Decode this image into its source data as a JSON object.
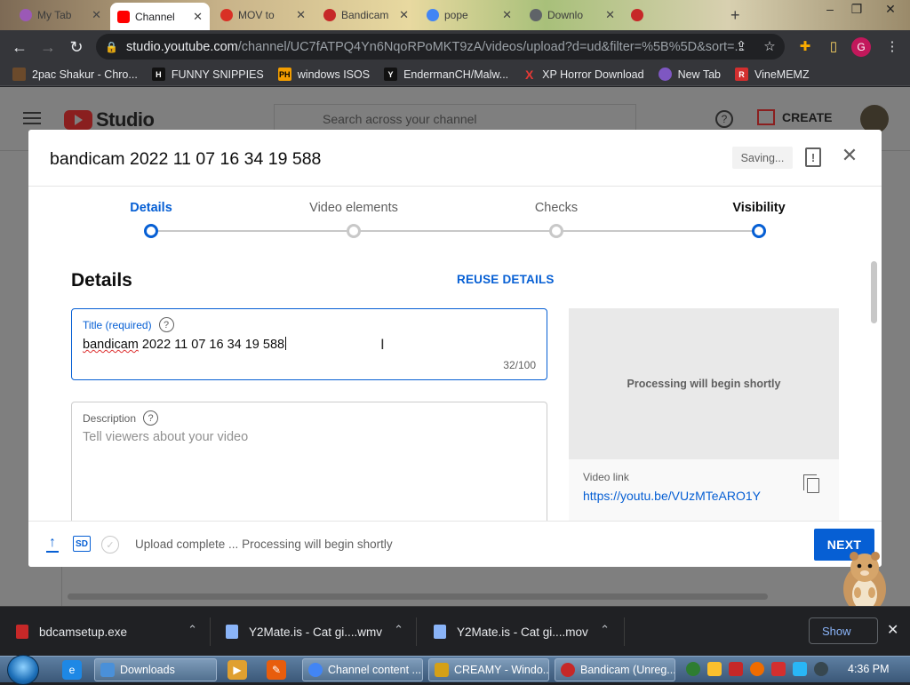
{
  "browser": {
    "tabs": [
      {
        "label": "My Tab",
        "fav": "#9b59b6"
      },
      {
        "label": "Channel",
        "fav": "#ff0000"
      },
      {
        "label": "MOV to",
        "fav": "#d93025"
      },
      {
        "label": "Bandicam",
        "fav": "#c62828"
      },
      {
        "label": "pope",
        "fav": "#4285f4"
      },
      {
        "label": "Downlo",
        "fav": "#5f6368"
      },
      {
        "label": "",
        "fav": "#c62828"
      }
    ],
    "new_tab": "+",
    "url_host": "studio.youtube.com",
    "url_path": "/channel/UC7fATPQ4Yn6NqoRPoMKT9zA/videos/upload?d=ud&filter=%5B%5D&sort=...",
    "profile_letter": "G"
  },
  "bookmarks": [
    {
      "label": "2pac Shakur - Chro...",
      "icon": "2pac-icon",
      "color": "#6b4a2b",
      "glyph": ""
    },
    {
      "label": "FUNNY SNIPPIES",
      "icon": "h-icon",
      "color": "#111111",
      "glyph": "H"
    },
    {
      "label": "windows ISOS",
      "icon": "ph-icon",
      "color": "#f29d00",
      "glyph": "PH"
    },
    {
      "label": "EndermanCH/Malw...",
      "icon": "yp-icon",
      "color": "#111111",
      "glyph": "Y"
    },
    {
      "label": "XP Horror Download",
      "icon": "x-icon",
      "color": "#e53935",
      "glyph": "X"
    },
    {
      "label": "New Tab",
      "icon": "globe-icon",
      "color": "#7e57c2",
      "glyph": ""
    },
    {
      "label": "VineMEMZ",
      "icon": "r-icon",
      "color": "#d32f2f",
      "glyph": "R"
    }
  ],
  "studio": {
    "logo_text": "Studio",
    "search_placeholder": "Search across your channel",
    "create_label": "CREATE"
  },
  "modal": {
    "title": "bandicam 2022 11 07 16 34 19 588",
    "saving_label": "Saving...",
    "steps": [
      {
        "label": "Details",
        "state": "current"
      },
      {
        "label": "Video elements",
        "state": "todo"
      },
      {
        "label": "Checks",
        "state": "todo"
      },
      {
        "label": "Visibility",
        "state": "current-end"
      }
    ],
    "section_title": "Details",
    "reuse_label": "REUSE DETAILS",
    "title_field": {
      "label": "Title (required)",
      "value_spell": "bandicam",
      "value_rest": " 2022 11 07 16 34 19 588",
      "count": "32/100"
    },
    "description_field": {
      "label": "Description",
      "placeholder": "Tell viewers about your video"
    },
    "preview_text": "Processing will begin shortly",
    "video_link_label": "Video link",
    "video_link": "https://youtu.be/VUzMTeARO1Y",
    "upload_status": "Upload complete ... Processing will begin shortly",
    "sd_badge": "SD",
    "next_label": "NEXT"
  },
  "downloads": [
    {
      "name": "bdcamsetup.exe",
      "color": "#c62828"
    },
    {
      "name": "Y2Mate.is - Cat gi....wmv",
      "color": "#8ab4f8"
    },
    {
      "name": "Y2Mate.is - Cat gi....mov",
      "color": "#8ab4f8"
    }
  ],
  "show_all_label": "Show",
  "taskbar": {
    "tasks": [
      {
        "label": "Downloads",
        "color": "#4a90d9"
      },
      {
        "label": "Channel content ...",
        "color": "#4285f4"
      },
      {
        "label": "CREAMY - Windo...",
        "color": "#d4a017"
      },
      {
        "label": "Bandicam (Unreg...",
        "color": "#c62828"
      }
    ],
    "clock": "4:36 PM"
  }
}
